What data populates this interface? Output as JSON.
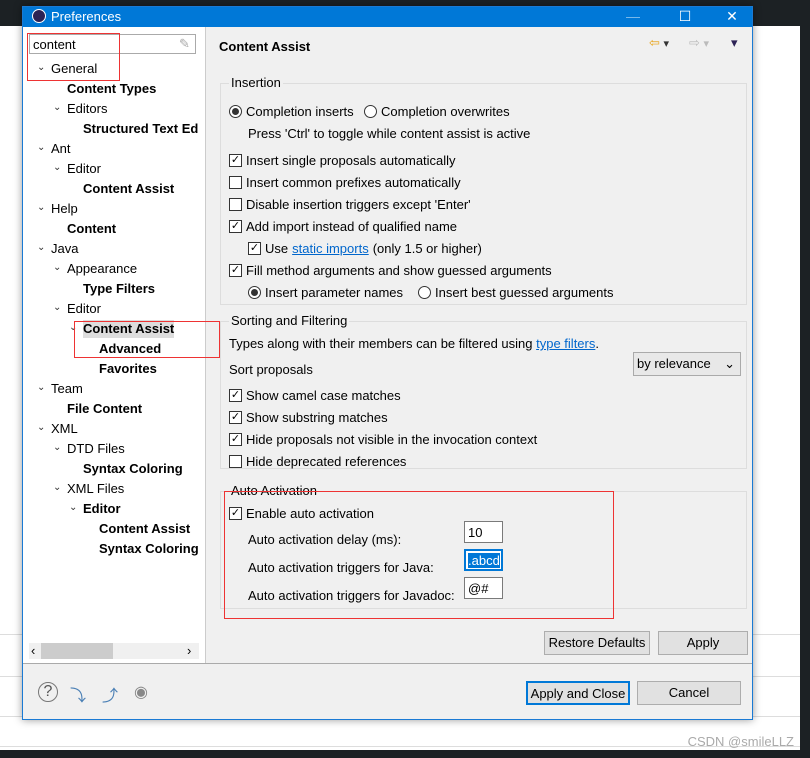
{
  "window": {
    "title": "Preferences",
    "minimize": "—",
    "maximize": "☐",
    "close": "✕"
  },
  "search": {
    "value": "content"
  },
  "tree": [
    {
      "label": "General",
      "level": 0,
      "bold": false,
      "chev": "v"
    },
    {
      "label": "Content Types",
      "level": 1,
      "bold": true,
      "chev": ""
    },
    {
      "label": "Editors",
      "level": 1,
      "bold": false,
      "chev": "v"
    },
    {
      "label": "Structured Text Ed",
      "level": 2,
      "bold": true,
      "chev": ""
    },
    {
      "label": "Ant",
      "level": 0,
      "bold": false,
      "chev": "v"
    },
    {
      "label": "Editor",
      "level": 1,
      "bold": false,
      "chev": "v"
    },
    {
      "label": "Content Assist",
      "level": 2,
      "bold": true,
      "chev": ""
    },
    {
      "label": "Help",
      "level": 0,
      "bold": false,
      "chev": "v"
    },
    {
      "label": "Content",
      "level": 1,
      "bold": true,
      "chev": ""
    },
    {
      "label": "Java",
      "level": 0,
      "bold": false,
      "chev": "v"
    },
    {
      "label": "Appearance",
      "level": 1,
      "bold": false,
      "chev": "v"
    },
    {
      "label": "Type Filters",
      "level": 2,
      "bold": true,
      "chev": ""
    },
    {
      "label": "Editor",
      "level": 1,
      "bold": false,
      "chev": "v"
    },
    {
      "label": "Content Assist",
      "level": 2,
      "bold": true,
      "chev": "v",
      "selected": true
    },
    {
      "label": "Advanced",
      "level": 3,
      "bold": true,
      "chev": ""
    },
    {
      "label": "Favorites",
      "level": 3,
      "bold": true,
      "chev": ""
    },
    {
      "label": "Team",
      "level": 0,
      "bold": false,
      "chev": "v"
    },
    {
      "label": "File Content",
      "level": 1,
      "bold": true,
      "chev": ""
    },
    {
      "label": "XML",
      "level": 0,
      "bold": false,
      "chev": "v"
    },
    {
      "label": "DTD Files",
      "level": 1,
      "bold": false,
      "chev": "v"
    },
    {
      "label": "Syntax Coloring",
      "level": 2,
      "bold": true,
      "chev": ""
    },
    {
      "label": "XML Files",
      "level": 1,
      "bold": false,
      "chev": "v"
    },
    {
      "label": "Editor",
      "level": 2,
      "bold": true,
      "chev": "v"
    },
    {
      "label": "Content Assist",
      "level": 3,
      "bold": true,
      "chev": ""
    },
    {
      "label": "Syntax Coloring",
      "level": 3,
      "bold": true,
      "chev": ""
    }
  ],
  "page": {
    "title": "Content Assist",
    "insertion": {
      "label": "Insertion",
      "completion_inserts": "Completion inserts",
      "completion_overwrites": "Completion overwrites",
      "toggle_hint": "Press 'Ctrl' to toggle while content assist is active",
      "single": "Insert single proposals automatically",
      "common": "Insert common prefixes automatically",
      "disable": "Disable insertion triggers except 'Enter'",
      "import": "Add import instead of qualified name",
      "use": "Use",
      "static_imports": "static imports",
      "only": "(only 1.5 or higher)",
      "fill": "Fill method arguments and show guessed arguments",
      "param_names": "Insert parameter names",
      "best_guessed": "Insert best guessed arguments"
    },
    "sorting": {
      "label": "Sorting and Filtering",
      "filter_text": "Types along with their members can be filtered using",
      "type_filters": "type filters",
      "period": ".",
      "sort_label": "Sort proposals",
      "sort_value": "by relevance",
      "camel": "Show camel case matches",
      "substring": "Show substring matches",
      "hide_not_visible": "Hide proposals not visible in the invocation context",
      "hide_deprecated": "Hide deprecated references"
    },
    "auto": {
      "label": "Auto Activation",
      "enable": "Enable auto activation",
      "delay_label": "Auto activation delay (ms):",
      "delay": "10",
      "java_label": "Auto activation triggers for Java:",
      "java": ".abcd",
      "javadoc_label": "Auto activation triggers for Javadoc:",
      "javadoc": "@#"
    },
    "restore": "Restore Defaults",
    "apply": "Apply"
  },
  "footer": {
    "apply_close": "Apply and Close",
    "cancel": "Cancel"
  },
  "watermark": "CSDN @smileLLZ"
}
